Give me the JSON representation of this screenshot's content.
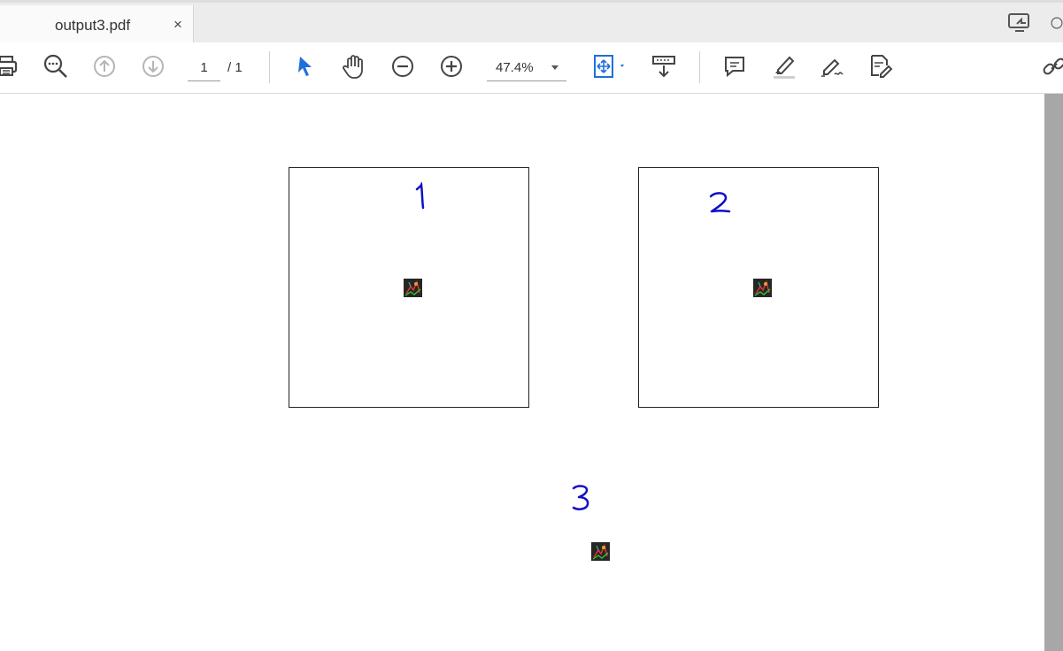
{
  "tab": {
    "title": "output3.pdf",
    "close_label": "×"
  },
  "toolbar": {
    "page_current": "1",
    "page_total": "/ 1",
    "zoom": "47.4%",
    "icons": [
      "print-icon",
      "zoom-search-icon",
      "page-up-icon",
      "page-down-icon",
      "select-cursor-icon",
      "hand-icon",
      "zoom-out-icon",
      "zoom-in-icon",
      "fit-page-icon",
      "scroll-mode-icon",
      "comment-icon",
      "highlight-icon",
      "sign-icon",
      "edit-text-icon",
      "link-icon"
    ]
  },
  "document": {
    "labels": [
      "1",
      "2",
      "3"
    ]
  },
  "colors": {
    "accent": "#1e6fd9",
    "ink": "#1010c8"
  }
}
